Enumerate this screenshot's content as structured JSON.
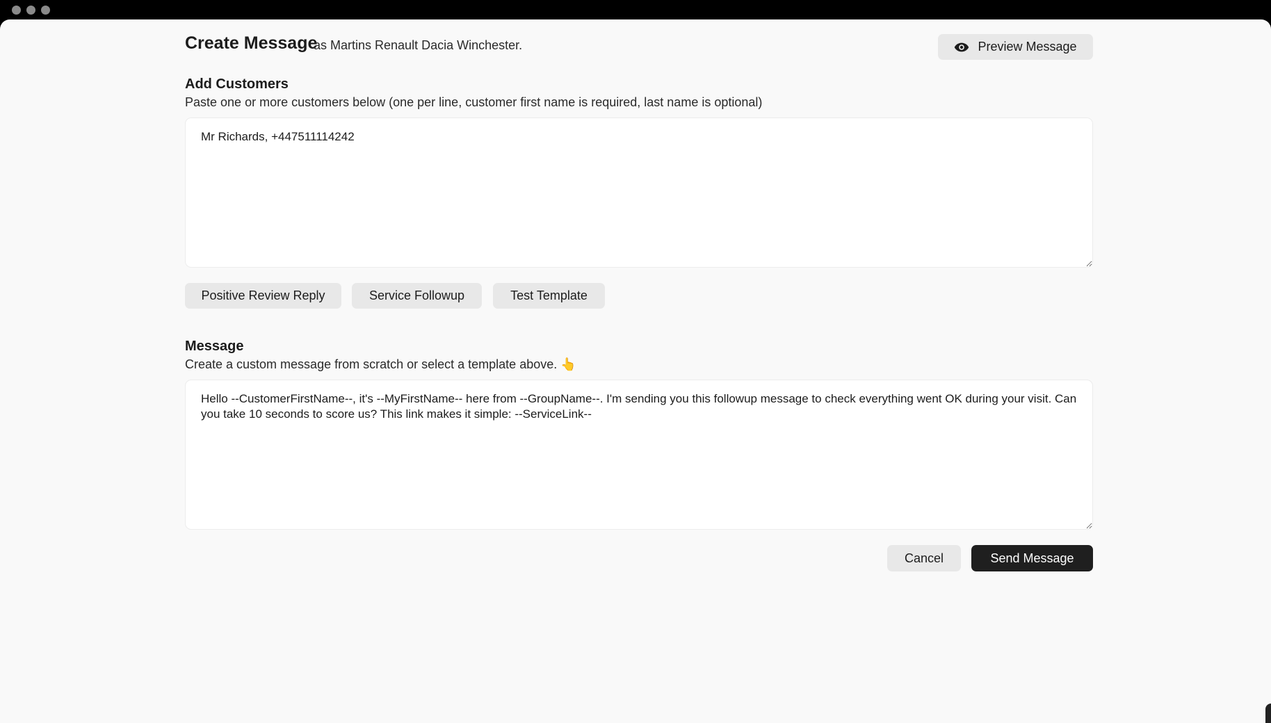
{
  "header": {
    "title": "Create Message",
    "subtitle": "as Martins Renault Dacia Winchester.",
    "preview_label": "Preview Message"
  },
  "customers": {
    "heading": "Add Customers",
    "description": "Paste one or more customers below (one per line, customer first name is required, last name is optional)",
    "value": "Mr Richards, +447511114242"
  },
  "templates": [
    {
      "label": "Positive Review Reply"
    },
    {
      "label": "Service Followup"
    },
    {
      "label": "Test Template"
    }
  ],
  "message": {
    "heading": "Message",
    "description": "Create a custom message from scratch or select a template above. 👆",
    "value": "Hello --CustomerFirstName--, it's --MyFirstName-- here from --GroupName--. I'm sending you this followup message to check everything went OK during your visit. Can you take 10 seconds to score us? This link makes it simple: --ServiceLink--"
  },
  "actions": {
    "cancel_label": "Cancel",
    "send_label": "Send Message"
  },
  "icons": {
    "preview": "eye-icon"
  },
  "colors": {
    "primary_button": "#1f1f1f",
    "secondary_button": "#e8e8e8",
    "background": "#f9f9f9"
  }
}
